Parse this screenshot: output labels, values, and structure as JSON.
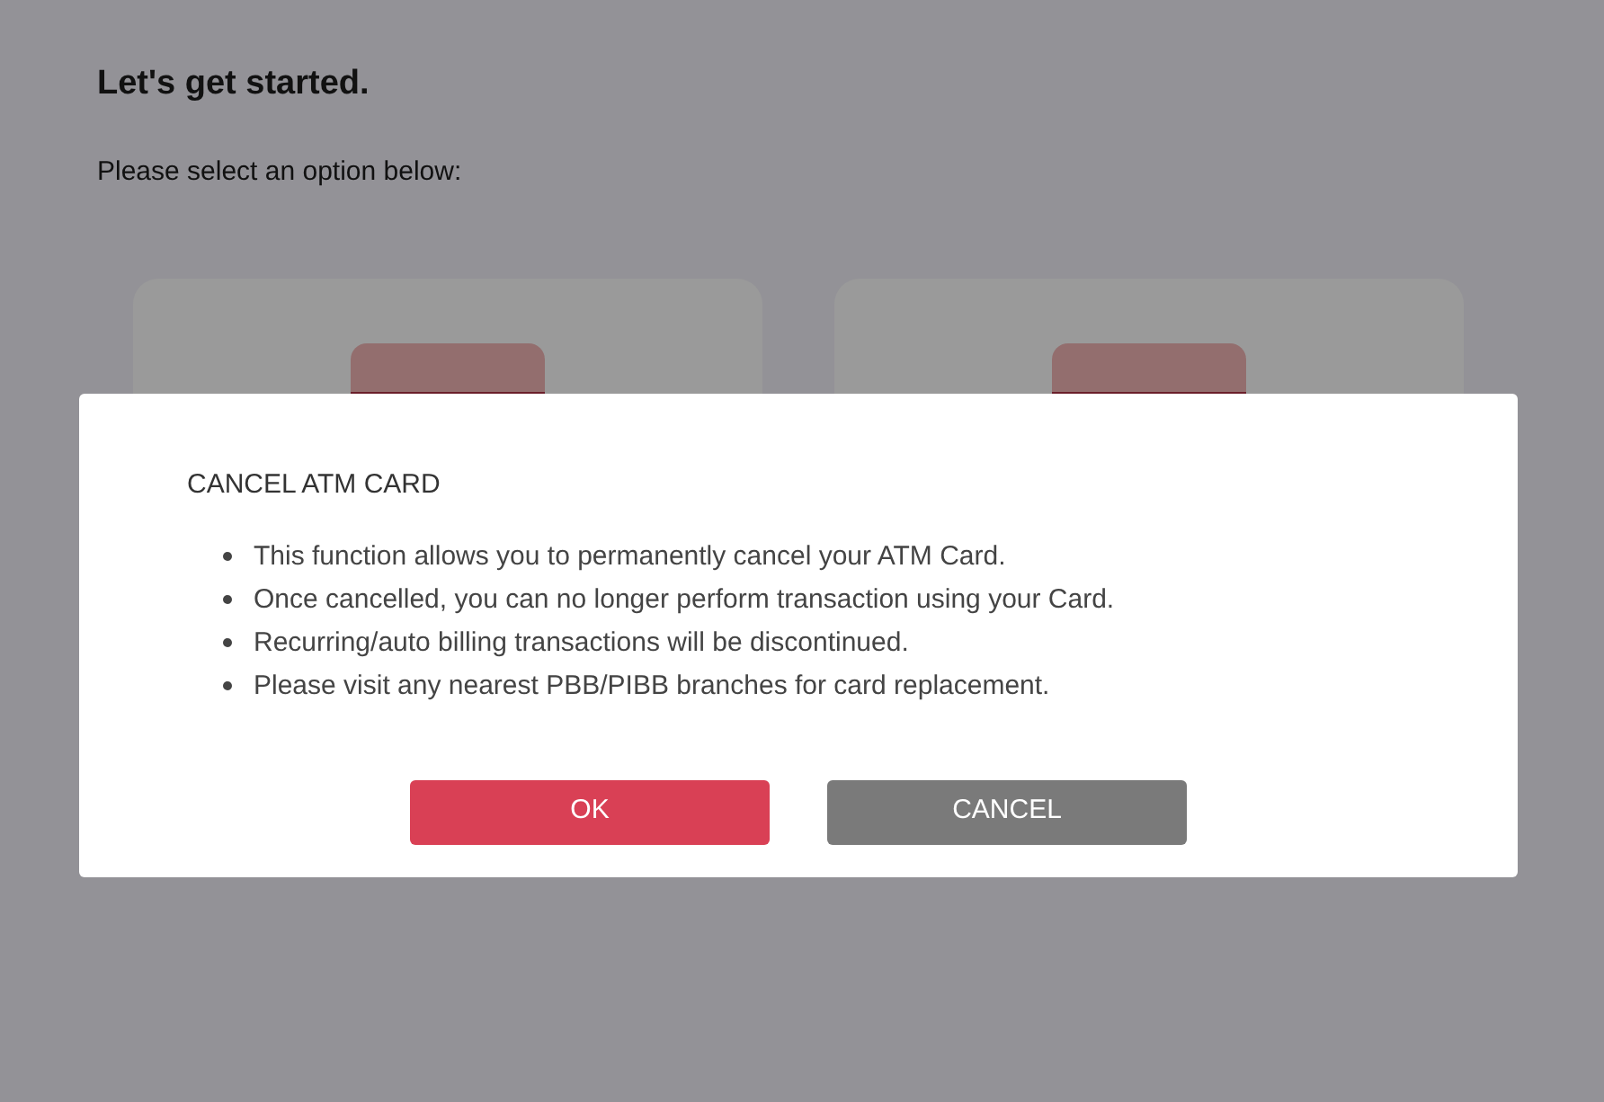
{
  "page": {
    "title": "Let's get started.",
    "subtitle": "Please select an option below:"
  },
  "dialog": {
    "title": "CANCEL ATM CARD",
    "bullets": [
      "This function allows you to permanently cancel your ATM Card.",
      "Once cancelled, you can no longer perform transaction using your Card.",
      "Recurring/auto billing transactions will be discontinued.",
      "Please visit any nearest PBB/PIBB branches for card replacement."
    ],
    "buttons": [
      {
        "label": "OK",
        "kind": "primary"
      },
      {
        "label": "CANCEL",
        "kind": "secondary"
      }
    ]
  }
}
